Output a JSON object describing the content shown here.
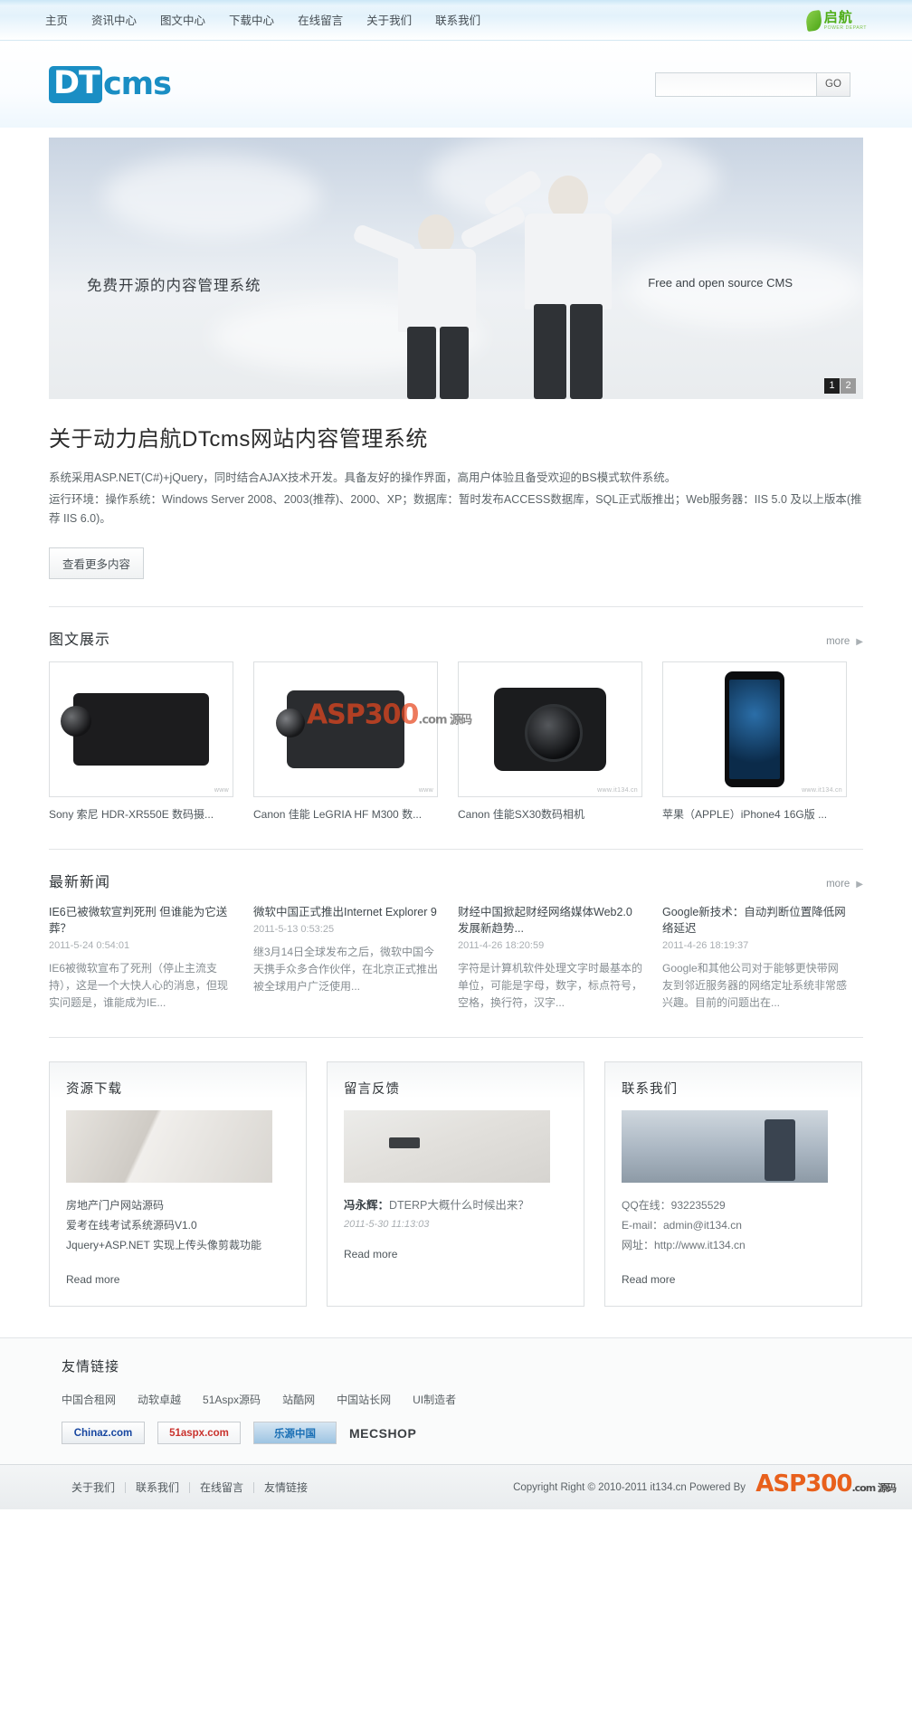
{
  "topbar": {
    "nav": [
      {
        "label": "主页"
      },
      {
        "label": "资讯中心"
      },
      {
        "label": "图文中心"
      },
      {
        "label": "下载中心"
      },
      {
        "label": "在线留言"
      },
      {
        "label": "关于我们"
      },
      {
        "label": "联系我们"
      }
    ],
    "brand_cn": "启航",
    "brand_en": "POWER DEPART",
    "brand_color": "#4fae17"
  },
  "header": {
    "logo_dt": "DT",
    "logo_cms": "cms",
    "logo_color": "#1a8ec4",
    "search": {
      "value": "",
      "placeholder": "",
      "button_label": "GO"
    }
  },
  "banner": {
    "headline_cn": "免费开源的内容管理系统",
    "headline_en": "Free and open source CMS",
    "pager": [
      {
        "label": "1",
        "active": true
      },
      {
        "label": "2",
        "active": false
      }
    ]
  },
  "about": {
    "title": "关于动力启航DTcms网站内容管理系统",
    "paragraphs": [
      "系统采用ASP.NET(C#)+jQuery，同时结合AJAX技术开发。具备友好的操作界面，高用户体验且备受欢迎的BS模式软件系统。",
      "运行环境：操作系统：Windows Server 2008、2003(推荐)、2000、XP；数据库：暂时发布ACCESS数据库，SQL正式版推出；Web服务器：IIS 5.0 及以上版本(推荐 IIS 6.0)。"
    ],
    "button_label": "查看更多内容"
  },
  "gallery": {
    "title": "图文展示",
    "more_label": "more",
    "items": [
      {
        "caption": "Sony 索尼 HDR-XR550E 数码摄...",
        "watermark": "www",
        "shape": "camcorder"
      },
      {
        "caption": "Canon 佳能 LeGRIA HF M300 数...",
        "watermark": "www",
        "shape": "camcorder2"
      },
      {
        "caption": "Canon 佳能SX30数码相机",
        "watermark": "www.it134.cn",
        "shape": "dslr"
      },
      {
        "caption": "苹果（APPLE）iPhone4 16G版 ...",
        "watermark": "www.it134.cn",
        "shape": "phone"
      }
    ],
    "overlay_watermark": "ASP300",
    "overlay_watermark_sub": ".com 源码"
  },
  "news": {
    "title": "最新新闻",
    "more_label": "more",
    "items": [
      {
        "title": "IE6已被微软宣判死刑 但谁能为它送葬？",
        "date": "2011-5-24 0:54:01",
        "desc": "IE6被微软宣布了死刑（停止主流支持），这是一个大快人心的消息，但现实问题是，谁能成为IE..."
      },
      {
        "title": "微软中国正式推出Internet Explorer 9",
        "date": "2011-5-13 0:53:25",
        "desc": "继3月14日全球发布之后，微软中国今天携手众多合作伙伴，在北京正式推出被全球用户广泛使用..."
      },
      {
        "title": "财经中国掀起财经网络媒体Web2.0发展新趋势...",
        "date": "2011-4-26 18:20:59",
        "desc": "字符是计算机软件处理文字时最基本的单位，可能是字母，数字，标点符号，空格，换行符，汉字..."
      },
      {
        "title": "Google新技术：自动判断位置降低网络延迟",
        "date": "2011-4-26 18:19:37",
        "desc": "Google和其他公司对于能够更快带网友到邻近服务器的网络定址系统非常感兴趣。目前的问题出在..."
      }
    ]
  },
  "panels": {
    "download": {
      "title": "资源下载",
      "items": [
        "房地产门户网站源码",
        "爱考在线考试系统源码V1.0",
        "Jquery+ASP.NET 实现上传头像剪裁功能"
      ],
      "readmore": "Read more"
    },
    "guestbook": {
      "title": "留言反馈",
      "author": "冯永辉：",
      "message": "DTERP大概什么时候出来？",
      "date": "2011-5-30 11:13:03",
      "readmore": "Read more"
    },
    "contact": {
      "title": "联系我们",
      "lines": [
        "QQ在线：932235529",
        "E-mail：admin@it134.cn",
        "网址：http://www.it134.cn"
      ],
      "readmore": "Read more"
    }
  },
  "friendlinks": {
    "title": "友情链接",
    "links": [
      {
        "label": "中国合租网"
      },
      {
        "label": "动软卓越"
      },
      {
        "label": "51Aspx源码"
      },
      {
        "label": "站酷网"
      },
      {
        "label": "中国站长网"
      },
      {
        "label": "UI制造者"
      }
    ],
    "logos": [
      {
        "label": "Chinaz.com",
        "style": "l1"
      },
      {
        "label": "51aspx.com",
        "style": "l2"
      },
      {
        "label": "乐源中国",
        "style": "l3"
      },
      {
        "label": "MECSHOP",
        "style": "l4"
      }
    ]
  },
  "footer": {
    "nav": [
      {
        "label": "关于我们"
      },
      {
        "label": "联系我们"
      },
      {
        "label": "在线留言"
      },
      {
        "label": "友情链接"
      }
    ],
    "copyright": "Copyright Right © 2010-2011 it134.cn Powered By",
    "brand": "ASP300",
    "brand_sub": ".com 源码"
  }
}
